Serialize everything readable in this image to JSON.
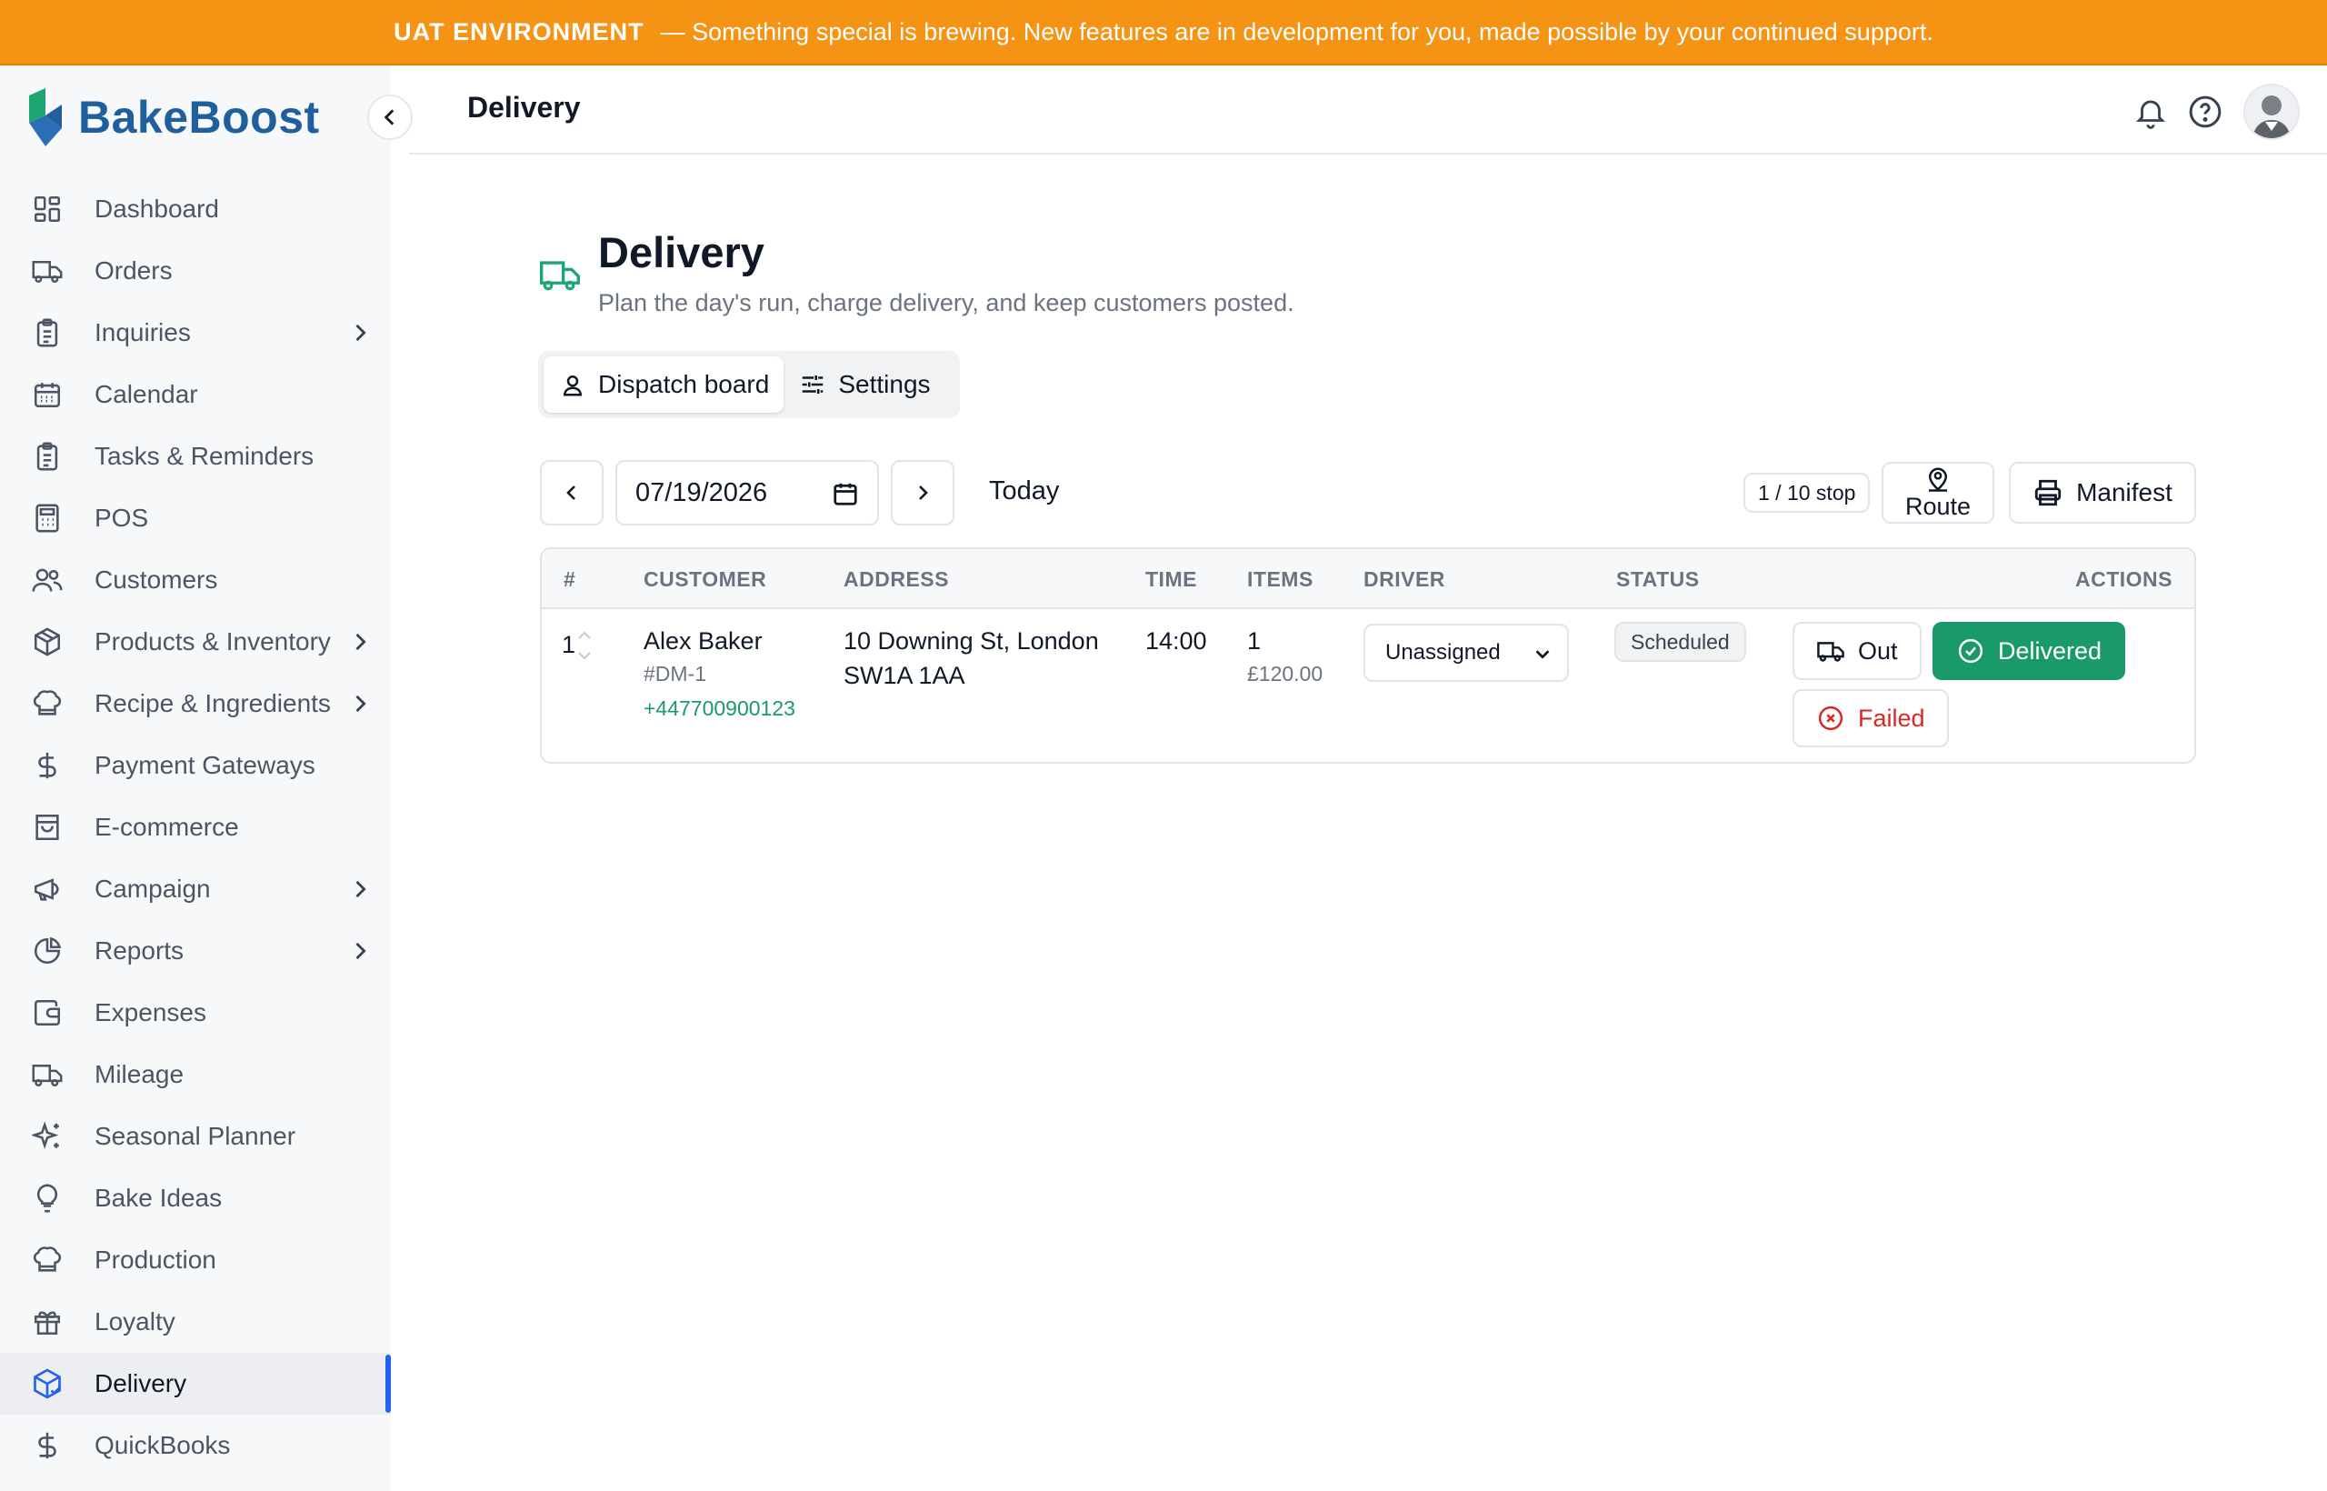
{
  "banner": {
    "env": "UAT ENVIRONMENT",
    "message": "— Something special is brewing. New features are in development for you, made possible by your continued support."
  },
  "brand": {
    "name": "BakeBoost"
  },
  "sidebar": {
    "items": [
      {
        "label": "Dashboard",
        "icon": "grid-icon"
      },
      {
        "label": "Orders",
        "icon": "truck-icon"
      },
      {
        "label": "Inquiries",
        "icon": "clipboard-icon",
        "submenu": true
      },
      {
        "label": "Calendar",
        "icon": "calendar-icon"
      },
      {
        "label": "Tasks & Reminders",
        "icon": "clipboard-icon"
      },
      {
        "label": "POS",
        "icon": "calculator-icon"
      },
      {
        "label": "Customers",
        "icon": "users-icon"
      },
      {
        "label": "Products & Inventory",
        "icon": "box-icon",
        "submenu": true
      },
      {
        "label": "Recipe & Ingredients",
        "icon": "chef-hat-icon",
        "submenu": true
      },
      {
        "label": "Payment Gateways",
        "icon": "dollar-icon"
      },
      {
        "label": "E-commerce",
        "icon": "shopping-bag-icon"
      },
      {
        "label": "Campaign",
        "icon": "megaphone-icon",
        "submenu": true
      },
      {
        "label": "Reports",
        "icon": "pie-chart-icon",
        "submenu": true
      },
      {
        "label": "Expenses",
        "icon": "wallet-icon"
      },
      {
        "label": "Mileage",
        "icon": "truck-icon"
      },
      {
        "label": "Seasonal Planner",
        "icon": "sparkles-icon"
      },
      {
        "label": "Bake Ideas",
        "icon": "lightbulb-icon"
      },
      {
        "label": "Production",
        "icon": "chef-hat-icon"
      },
      {
        "label": "Loyalty",
        "icon": "gift-icon"
      },
      {
        "label": "Delivery",
        "icon": "package-check-icon",
        "active": true
      },
      {
        "label": "QuickBooks",
        "icon": "dollar-icon"
      }
    ]
  },
  "header": {
    "title": "Delivery"
  },
  "page": {
    "title": "Delivery",
    "subtitle": "Plan the day's run, charge delivery, and keep customers posted."
  },
  "tabs": [
    {
      "label": "Dispatch board",
      "active": true
    },
    {
      "label": "Settings",
      "active": false
    }
  ],
  "toolbar": {
    "date": "07/19/2026",
    "today_label": "Today",
    "stop_count": "1 / 10 stop",
    "route_label": "Route",
    "manifest_label": "Manifest"
  },
  "table": {
    "columns": [
      "#",
      "CUSTOMER",
      "ADDRESS",
      "TIME",
      "ITEMS",
      "DRIVER",
      "STATUS",
      "ACTIONS"
    ],
    "rows": [
      {
        "index": "1",
        "customer": "Alex Baker",
        "order_id": "#DM-1",
        "phone": "+447700900123",
        "address_line1": "10 Downing St, London",
        "address_line2": "SW1A 1AA",
        "time": "14:00",
        "items": "1",
        "amount": "£120.00",
        "driver": "Unassigned",
        "status": "Scheduled",
        "actions": {
          "out": "Out",
          "delivered": "Delivered",
          "failed": "Failed"
        }
      }
    ]
  },
  "colors": {
    "banner": "#f59315",
    "brand": "#1f5f9e",
    "accent_green": "#1a9a6b",
    "active_blue": "#2563eb",
    "danger": "#dc2626"
  }
}
